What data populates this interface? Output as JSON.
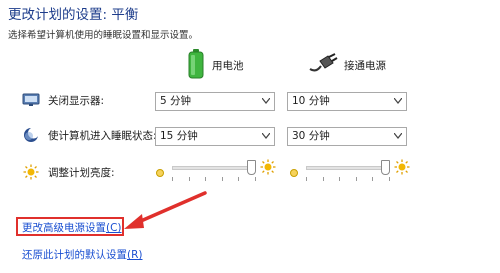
{
  "page": {
    "title": "更改计划的设置: 平衡",
    "subtitle": "选择希望计算机使用的睡眠设置和显示设置。"
  },
  "columns": {
    "battery": {
      "label": "用电池",
      "icon": "battery-icon"
    },
    "plugged_in": {
      "label": "接通电源",
      "icon": "power-plug-icon"
    }
  },
  "settings": {
    "display_off": {
      "label": "关闭显示器:",
      "icon": "monitor-icon",
      "battery_value": "5 分钟",
      "plugged_in_value": "10 分钟"
    },
    "sleep": {
      "label": "使计算机进入睡眠状态:",
      "icon": "moon-sleep-icon",
      "battery_value": "15 分钟",
      "plugged_in_value": "30 分钟"
    },
    "brightness": {
      "label": "调整计划亮度:",
      "icon": "sun-brightness-icon",
      "battery_level": 1.0,
      "plugged_in_level": 1.0
    }
  },
  "links": {
    "advanced_settings": {
      "text": "更改高级电源设置",
      "accesskey": "(C)"
    },
    "restore_defaults": {
      "text": "还原此计划的默认设置",
      "accesskey": "(R)"
    }
  },
  "colors": {
    "title": "#1d3c8b",
    "link": "#1a4fd1",
    "annotation_red": "#e0302c"
  }
}
